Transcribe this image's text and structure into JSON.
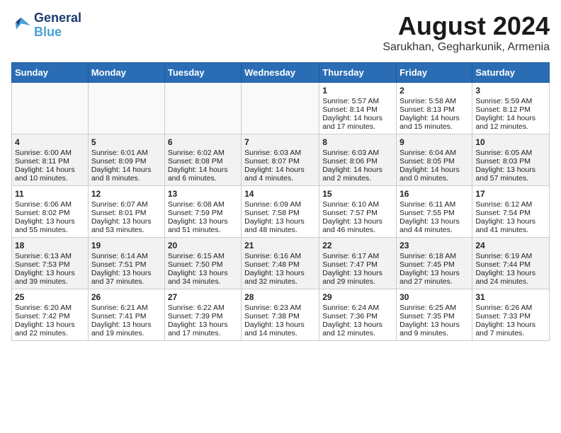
{
  "logo": {
    "line1": "General",
    "line2": "Blue"
  },
  "title": "August 2024",
  "location": "Sarukhan, Gegharkunik, Armenia",
  "weekdays": [
    "Sunday",
    "Monday",
    "Tuesday",
    "Wednesday",
    "Thursday",
    "Friday",
    "Saturday"
  ],
  "weeks": [
    [
      {
        "day": "",
        "content": ""
      },
      {
        "day": "",
        "content": ""
      },
      {
        "day": "",
        "content": ""
      },
      {
        "day": "",
        "content": ""
      },
      {
        "day": "1",
        "content": "Sunrise: 5:57 AM\nSunset: 8:14 PM\nDaylight: 14 hours\nand 17 minutes."
      },
      {
        "day": "2",
        "content": "Sunrise: 5:58 AM\nSunset: 8:13 PM\nDaylight: 14 hours\nand 15 minutes."
      },
      {
        "day": "3",
        "content": "Sunrise: 5:59 AM\nSunset: 8:12 PM\nDaylight: 14 hours\nand 12 minutes."
      }
    ],
    [
      {
        "day": "4",
        "content": "Sunrise: 6:00 AM\nSunset: 8:11 PM\nDaylight: 14 hours\nand 10 minutes."
      },
      {
        "day": "5",
        "content": "Sunrise: 6:01 AM\nSunset: 8:09 PM\nDaylight: 14 hours\nand 8 minutes."
      },
      {
        "day": "6",
        "content": "Sunrise: 6:02 AM\nSunset: 8:08 PM\nDaylight: 14 hours\nand 6 minutes."
      },
      {
        "day": "7",
        "content": "Sunrise: 6:03 AM\nSunset: 8:07 PM\nDaylight: 14 hours\nand 4 minutes."
      },
      {
        "day": "8",
        "content": "Sunrise: 6:03 AM\nSunset: 8:06 PM\nDaylight: 14 hours\nand 2 minutes."
      },
      {
        "day": "9",
        "content": "Sunrise: 6:04 AM\nSunset: 8:05 PM\nDaylight: 14 hours\nand 0 minutes."
      },
      {
        "day": "10",
        "content": "Sunrise: 6:05 AM\nSunset: 8:03 PM\nDaylight: 13 hours\nand 57 minutes."
      }
    ],
    [
      {
        "day": "11",
        "content": "Sunrise: 6:06 AM\nSunset: 8:02 PM\nDaylight: 13 hours\nand 55 minutes."
      },
      {
        "day": "12",
        "content": "Sunrise: 6:07 AM\nSunset: 8:01 PM\nDaylight: 13 hours\nand 53 minutes."
      },
      {
        "day": "13",
        "content": "Sunrise: 6:08 AM\nSunset: 7:59 PM\nDaylight: 13 hours\nand 51 minutes."
      },
      {
        "day": "14",
        "content": "Sunrise: 6:09 AM\nSunset: 7:58 PM\nDaylight: 13 hours\nand 48 minutes."
      },
      {
        "day": "15",
        "content": "Sunrise: 6:10 AM\nSunset: 7:57 PM\nDaylight: 13 hours\nand 46 minutes."
      },
      {
        "day": "16",
        "content": "Sunrise: 6:11 AM\nSunset: 7:55 PM\nDaylight: 13 hours\nand 44 minutes."
      },
      {
        "day": "17",
        "content": "Sunrise: 6:12 AM\nSunset: 7:54 PM\nDaylight: 13 hours\nand 41 minutes."
      }
    ],
    [
      {
        "day": "18",
        "content": "Sunrise: 6:13 AM\nSunset: 7:53 PM\nDaylight: 13 hours\nand 39 minutes."
      },
      {
        "day": "19",
        "content": "Sunrise: 6:14 AM\nSunset: 7:51 PM\nDaylight: 13 hours\nand 37 minutes."
      },
      {
        "day": "20",
        "content": "Sunrise: 6:15 AM\nSunset: 7:50 PM\nDaylight: 13 hours\nand 34 minutes."
      },
      {
        "day": "21",
        "content": "Sunrise: 6:16 AM\nSunset: 7:48 PM\nDaylight: 13 hours\nand 32 minutes."
      },
      {
        "day": "22",
        "content": "Sunrise: 6:17 AM\nSunset: 7:47 PM\nDaylight: 13 hours\nand 29 minutes."
      },
      {
        "day": "23",
        "content": "Sunrise: 6:18 AM\nSunset: 7:45 PM\nDaylight: 13 hours\nand 27 minutes."
      },
      {
        "day": "24",
        "content": "Sunrise: 6:19 AM\nSunset: 7:44 PM\nDaylight: 13 hours\nand 24 minutes."
      }
    ],
    [
      {
        "day": "25",
        "content": "Sunrise: 6:20 AM\nSunset: 7:42 PM\nDaylight: 13 hours\nand 22 minutes."
      },
      {
        "day": "26",
        "content": "Sunrise: 6:21 AM\nSunset: 7:41 PM\nDaylight: 13 hours\nand 19 minutes."
      },
      {
        "day": "27",
        "content": "Sunrise: 6:22 AM\nSunset: 7:39 PM\nDaylight: 13 hours\nand 17 minutes."
      },
      {
        "day": "28",
        "content": "Sunrise: 6:23 AM\nSunset: 7:38 PM\nDaylight: 13 hours\nand 14 minutes."
      },
      {
        "day": "29",
        "content": "Sunrise: 6:24 AM\nSunset: 7:36 PM\nDaylight: 13 hours\nand 12 minutes."
      },
      {
        "day": "30",
        "content": "Sunrise: 6:25 AM\nSunset: 7:35 PM\nDaylight: 13 hours\nand 9 minutes."
      },
      {
        "day": "31",
        "content": "Sunrise: 6:26 AM\nSunset: 7:33 PM\nDaylight: 13 hours\nand 7 minutes."
      }
    ]
  ]
}
